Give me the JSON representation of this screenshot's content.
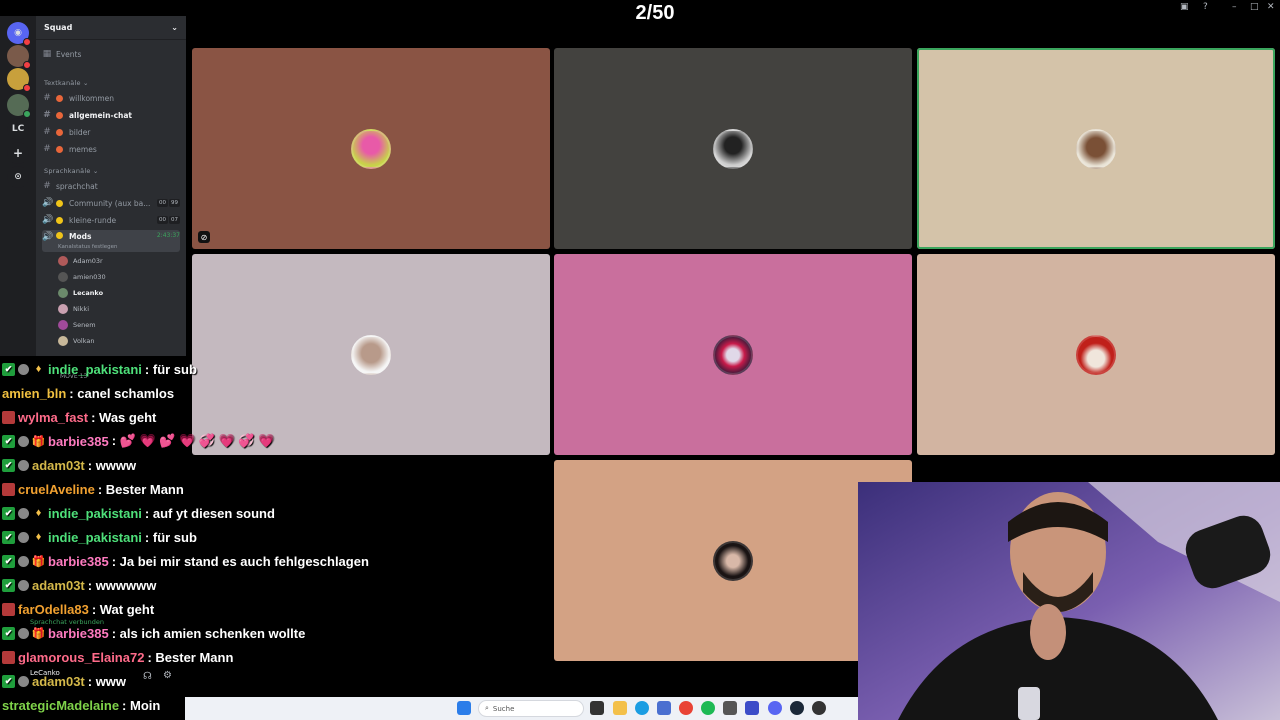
{
  "counter": "2/50",
  "server": {
    "name": "Squad",
    "events": "Events"
  },
  "sidebar": {
    "text_category": "Textkanäle",
    "text_channels": [
      "willkommen",
      "allgemein-chat",
      "bilder",
      "memes"
    ],
    "voice_category": "Sprachkanäle",
    "voice_channels": [
      {
        "name": "sprachchat"
      },
      {
        "name": "Community (aux ba...",
        "count_a": "00",
        "count_b": "99"
      },
      {
        "name": "kleine-runde",
        "count_a": "00",
        "count_b": "07"
      },
      {
        "name": "Mods",
        "timer": "2:43:37",
        "status": "Kanalstatus festlegen"
      }
    ],
    "members": [
      "Adam03r",
      "amien030",
      "Lecanko",
      "Nikki",
      "Senem",
      "Volkan"
    ],
    "move_label": "MOVE",
    "move_count": "13",
    "connected": "Sprachchat verbunden",
    "user": "LeCanko",
    "rail_label": "LC"
  },
  "chat": [
    {
      "user": "indie_pakistani",
      "text": " : für sub",
      "color": "#4ee07a",
      "badges": [
        "check",
        "circ",
        "gem"
      ]
    },
    {
      "user": "amien_bln",
      "text": " : canel schamlos",
      "color": "#f0c040",
      "badges": []
    },
    {
      "user": "wylma_fast",
      "text": " : Was geht",
      "color": "#ff6b8a",
      "badges": [
        "red"
      ]
    },
    {
      "user": "barbie385",
      "text": " : 💕 💗 💕 💗 💞 💗 💞 💗",
      "color": "#ff7bc0",
      "badges": [
        "check",
        "circ",
        "gift"
      ]
    },
    {
      "user": "adam03t",
      "text": " : wwww",
      "color": "#d4b84a",
      "badges": [
        "check",
        "circ"
      ]
    },
    {
      "user": "cruelAveline",
      "text": " : Bester Mann",
      "color": "#f0a030",
      "badges": [
        "red"
      ]
    },
    {
      "user": "indie_pakistani",
      "text": " : auf yt diesen sound",
      "color": "#4ee07a",
      "badges": [
        "check",
        "circ",
        "gem"
      ]
    },
    {
      "user": "indie_pakistani",
      "text": " : für sub",
      "color": "#4ee07a",
      "badges": [
        "check",
        "circ",
        "gem"
      ]
    },
    {
      "user": "barbie385",
      "text": " : Ja bei mir stand es auch fehlgeschlagen",
      "color": "#ff7bc0",
      "badges": [
        "check",
        "circ",
        "gift"
      ]
    },
    {
      "user": "adam03t",
      "text": " : wwwwww",
      "color": "#d4b84a",
      "badges": [
        "check",
        "circ"
      ]
    },
    {
      "user": "farOdella83",
      "text": " : Wat geht",
      "color": "#f0a030",
      "badges": [
        "red"
      ]
    },
    {
      "user": "barbie385",
      "text": " : als ich amien schenken wollte",
      "color": "#ff7bc0",
      "badges": [
        "check",
        "circ",
        "gift"
      ]
    },
    {
      "user": "glamorous_Elaina72",
      "text": " : Bester Mann",
      "color": "#ff6b8a",
      "badges": [
        "red"
      ]
    },
    {
      "user": "adam03t",
      "text": " : www",
      "color": "#d4b84a",
      "badges": [
        "check",
        "circ"
      ]
    },
    {
      "user": "strategicMadelaine",
      "text": " : Moin",
      "color": "#7fd34a",
      "badges": []
    }
  ],
  "taskbar": {
    "search_placeholder": "Suche"
  },
  "colors": {
    "tile1": "#8a5444",
    "tile2": "#43423f",
    "tile3": "#d4c3a9",
    "tile4": "#c4b9bf",
    "tile5": "#c96f9d",
    "tile6": "#d2b4a1",
    "tile7": "#d3a284"
  }
}
